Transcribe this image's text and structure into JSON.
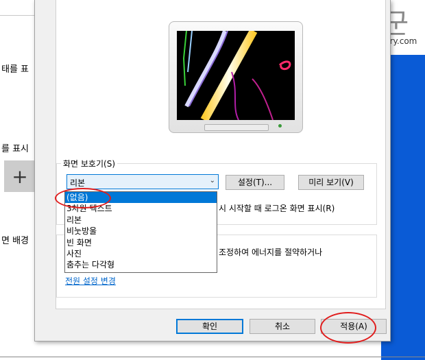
{
  "background": {
    "fragments": [
      "태를 표",
      "를 표시",
      "면 배경"
    ],
    "add_label": "+"
  },
  "watermark": {
    "title": "녹두장군",
    "url": "http://mainia.tistory.com"
  },
  "screensaver_group": {
    "title": "화면 보호기(S)",
    "selected": "리본",
    "settings_button": "설정(T)...",
    "preview_button": "미리 보기(V)",
    "resume_text": "시 시작할 때 로그온 화면 표시(R)",
    "options": [
      "(없음)",
      "3차원 텍스트",
      "리본",
      "비눗방울",
      "빈 화면",
      "사진",
      "춤추는 다각형"
    ],
    "highlighted_index": 0
  },
  "power_group": {
    "text": "조정하여 에너지를 절약하거나",
    "link": "전원 설정 변경"
  },
  "buttons": {
    "ok": "확인",
    "cancel": "취소",
    "apply": "적용(A)"
  },
  "colors": {
    "accent": "#0078d7",
    "annotation": "#e01c1c",
    "desktop_blue": "#0a5bd6"
  }
}
